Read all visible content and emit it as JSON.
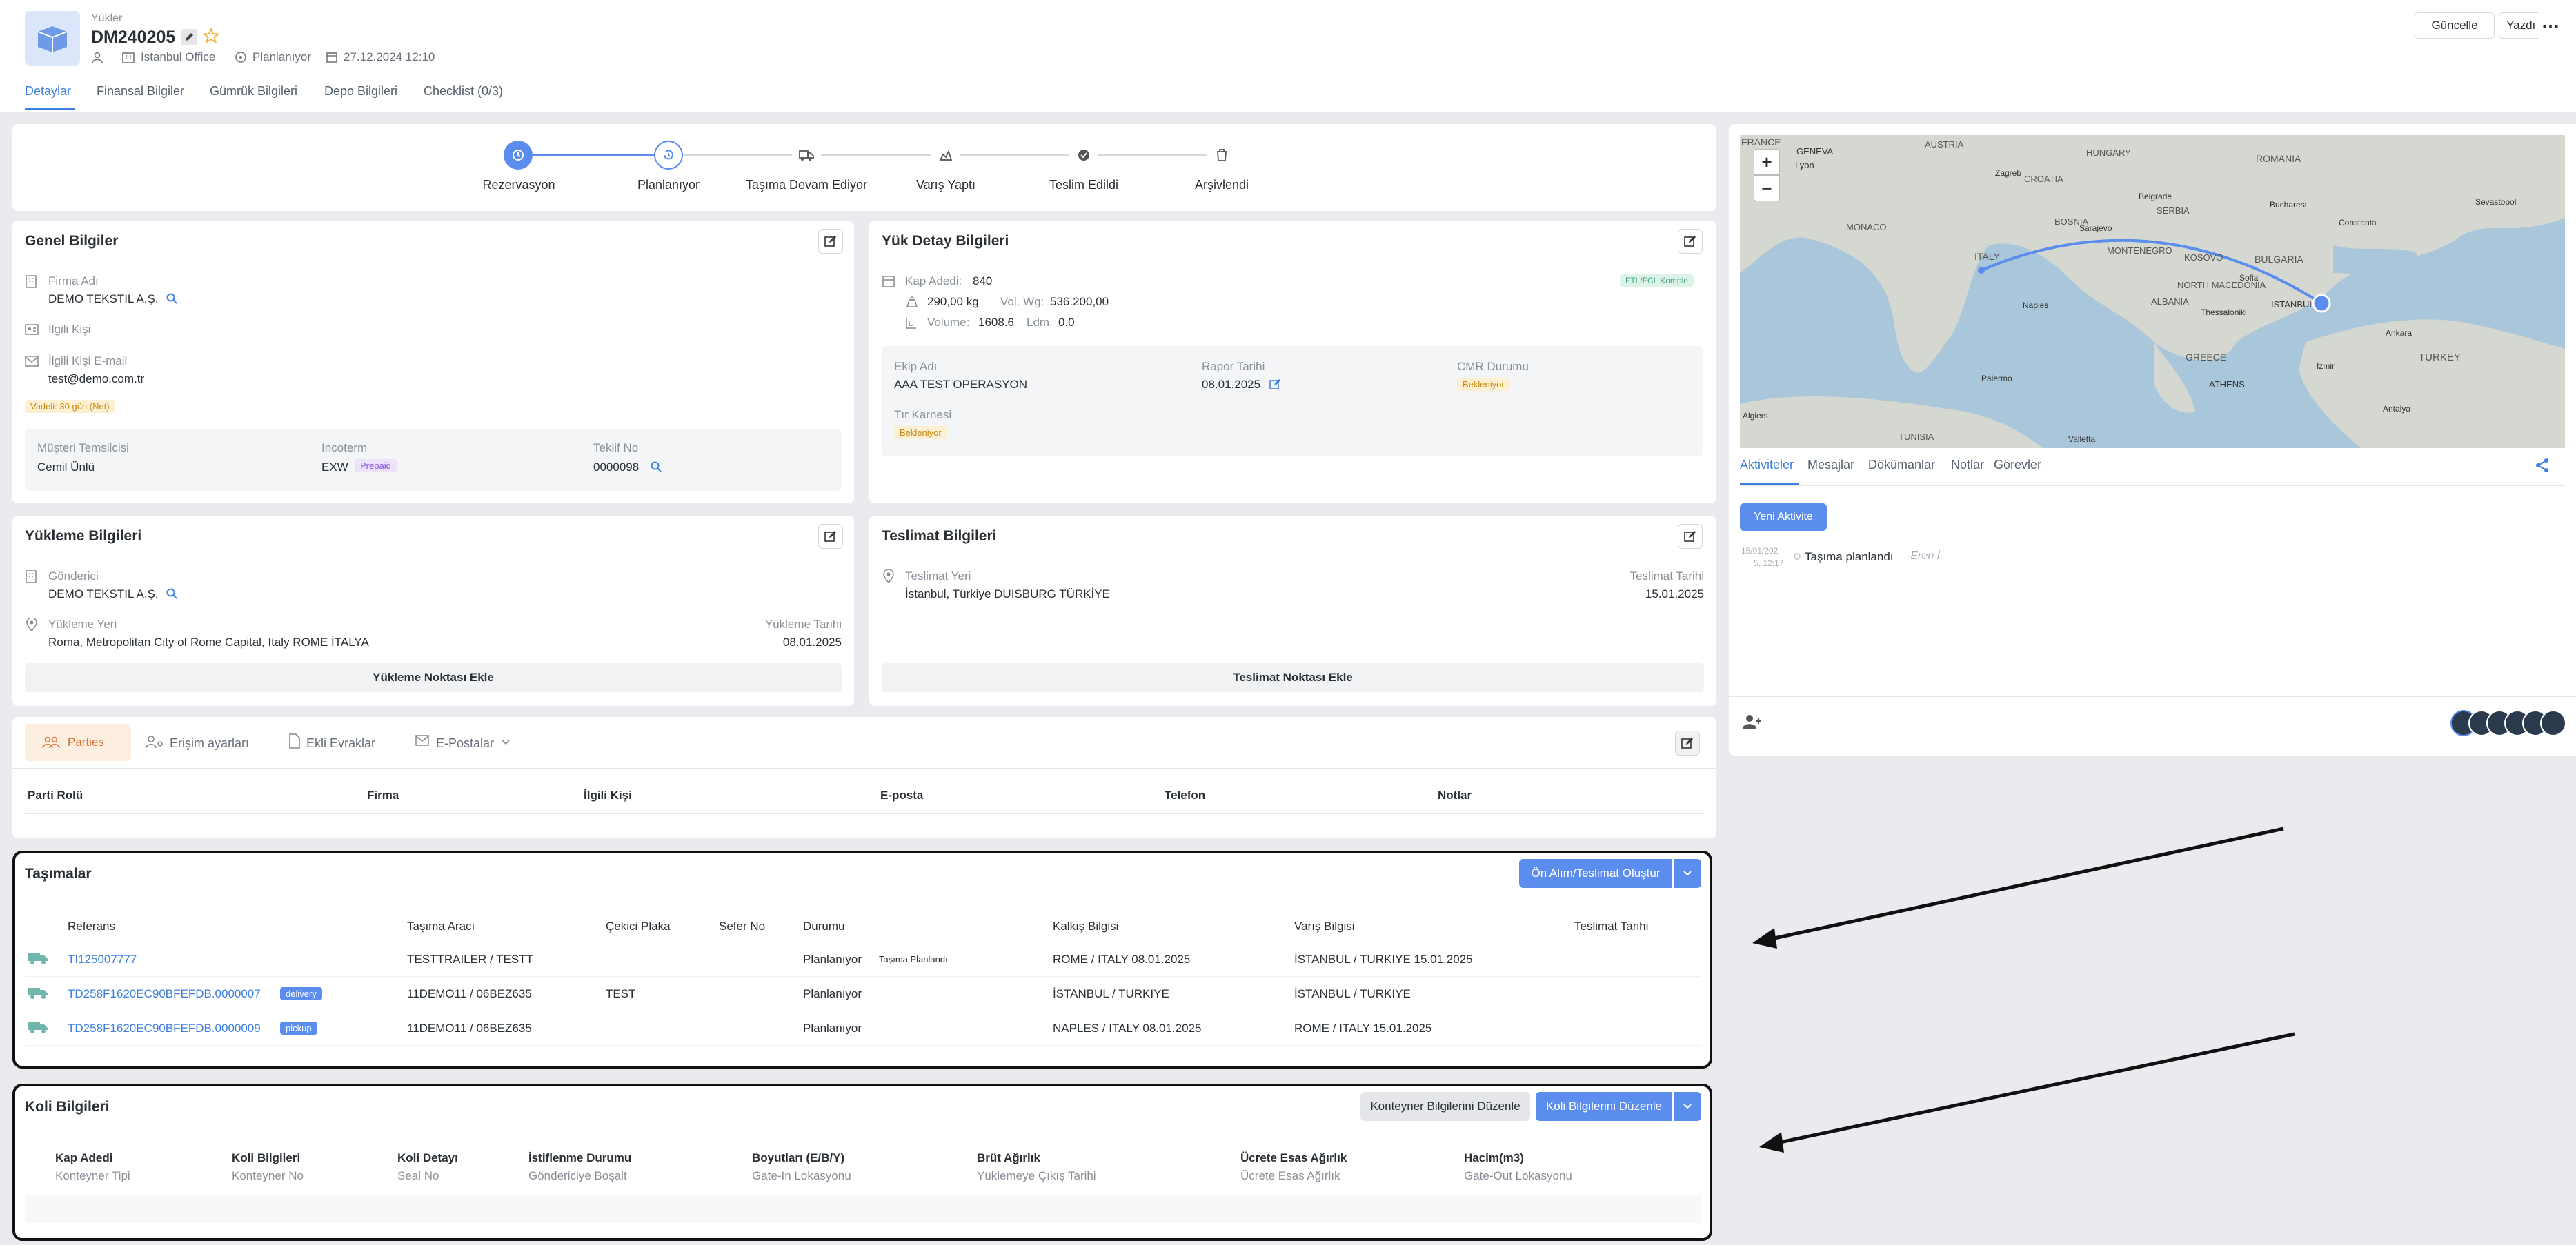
{
  "header": {
    "breadcrumb": "Yükler",
    "title": "DM240205",
    "office": "Istanbul Office",
    "status": "Planlanıyor",
    "date": "27.12.2024 12:10",
    "update_label": "Güncelle",
    "print_label": "Yazdır",
    "tabs": [
      "Detaylar",
      "Finansal Bilgiler",
      "Gümrük Bilgileri",
      "Depo Bilgileri",
      "Checklist (0/3)"
    ]
  },
  "progress": {
    "steps": [
      "Rezervasyon",
      "Planlanıyor",
      "Taşıma Devam Ediyor",
      "Varış Yaptı",
      "Teslim Edildi",
      "Arşivlendi"
    ],
    "active_index": 1
  },
  "genel": {
    "title": "Genel Bilgiler",
    "firma_label": "Firma Adı",
    "firma": "DEMO TEKSTIL A.Ş.",
    "ilgili_label": "İlgili Kişi",
    "email_label": "İlgili Kişi E-mail",
    "email": "test@demo.com.tr",
    "vade": "Vadeli: 30 gün (Net)",
    "temsilci_label": "Müşteri Temsilcisi",
    "temsilci": "Cemil Ünlü",
    "incoterm_label": "Incoterm",
    "incoterm": "EXW",
    "prepaid": "Prepaid",
    "teklif_label": "Teklif No",
    "teklif": "0000098"
  },
  "yuk": {
    "title": "Yük Detay Bilgileri",
    "kap_label": "Kap Adedi:",
    "kap": "840",
    "ftl": "FTL/FCL Komple",
    "weight": "290,00 kg",
    "volwg_label": "Vol. Wg:",
    "volwg": "536.200,00",
    "volume_label": "Volume:",
    "volume": "1608.6",
    "ldm_label": "Ldm.",
    "ldm": "0.0",
    "ekip_label": "Ekip Adı",
    "ekip": "AAA TEST OPERASYON",
    "rapor_label": "Rapor Tarihi",
    "rapor": "08.01.2025",
    "cmr_label": "CMR Durumu",
    "cmr": "Bekleniyor",
    "tir_label": "Tır Karnesi",
    "tir": "Bekleniyor"
  },
  "yukleme": {
    "title": "Yükleme Bilgileri",
    "gonderici_label": "Gönderici",
    "gonderici": "DEMO TEKSTIL A.Ş.",
    "yer_label": "Yükleme Yeri",
    "yer": "Roma, Metropolitan City of Rome Capital, Italy ROME İTALYA",
    "tarih_label": "Yükleme Tarihi",
    "tarih": "08.01.2025",
    "add_label": "Yükleme Noktası Ekle"
  },
  "teslimat": {
    "title": "Teslimat Bilgileri",
    "yer_label": "Teslimat Yeri",
    "yer": "İstanbul, Türkiye DUISBURG TÜRKİYE",
    "tarih_label": "Teslimat Tarihi",
    "tarih": "15.01.2025",
    "add_label": "Teslimat Noktası Ekle"
  },
  "parties": {
    "tabs": [
      "Parties",
      "Erişim ayarları",
      "Ekli Evraklar",
      "E-Postalar"
    ],
    "columns": [
      "Parti Rolü",
      "Firma",
      "İlgili Kişi",
      "E-posta",
      "Telefon",
      "Notlar"
    ]
  },
  "tasimalar": {
    "title": "Taşımalar",
    "create_label": "Ön Alım/Teslimat Oluştur",
    "columns": [
      "Referans",
      "Taşıma Aracı",
      "Çekici Plaka",
      "Sefer No",
      "Durumu",
      "Kalkış Bilgisi",
      "Varış Bilgisi",
      "Teslimat Tarihi"
    ],
    "rows": [
      {
        "ref": "TI125007777",
        "tag": "",
        "arac": "TESTTRAILER / TESTT",
        "cekici": "",
        "sefer": "",
        "durum": "Planlanıyor",
        "durum2": "Taşıma Planlandı",
        "kalkis": "ROME / ITALY 08.01.2025",
        "varis": "İSTANBUL / TURKIYE 15.01.2025",
        "teslimat": ""
      },
      {
        "ref": "TD258F1620EC90BFEFDB.0000007",
        "tag": "delivery",
        "arac": "11DEMO11 / 06BEZ635",
        "cekici": "TEST",
        "sefer": "",
        "durum": "Planlanıyor",
        "durum2": "",
        "kalkis": "İSTANBUL / TURKIYE",
        "varis": "İSTANBUL / TURKIYE",
        "teslimat": ""
      },
      {
        "ref": "TD258F1620EC90BFEFDB.0000009",
        "tag": "pickup",
        "arac": "11DEMO11 / 06BEZ635",
        "cekici": "",
        "sefer": "",
        "durum": "Planlanıyor",
        "durum2": "",
        "kalkis": "NAPLES / ITALY 08.01.2025",
        "varis": "ROME / ITALY 15.01.2025",
        "teslimat": ""
      }
    ]
  },
  "koli": {
    "title": "Koli Bilgileri",
    "konteyner_label": "Konteyner Bilgilerini Düzenle",
    "koli_label": "Koli Bilgilerini Düzenle",
    "columns": [
      {
        "top": "Kap Adedi",
        "bottom": "Konteyner Tipi"
      },
      {
        "top": "Koli Bilgileri",
        "bottom": "Konteyner No"
      },
      {
        "top": "Koli Detayı",
        "bottom": "Seal No"
      },
      {
        "top": "İstiflenme Durumu",
        "bottom": "Göndericiye Boşalt"
      },
      {
        "top": "Boyutları (E/B/Y)",
        "bottom": "Gate-In Lokasyonu"
      },
      {
        "top": "Brüt Ağırlık",
        "bottom": "Yüklemeye Çıkış Tarihi"
      },
      {
        "top": "Ücrete Esas Ağırlık",
        "bottom": "Ücrete Esas Ağırlık"
      },
      {
        "top": "Hacim(m3)",
        "bottom": "Gate-Out Lokasyonu"
      }
    ]
  },
  "map": {
    "zoom_in": "+",
    "zoom_out": "−",
    "labels": [
      "FRANCE",
      "GENEVA",
      "Lyon",
      "AUSTRIA",
      "HUNGARY",
      "ROMANIA",
      "CROATIA",
      "Zagreb",
      "Belgrade",
      "SERBIA",
      "Bucharest",
      "Sevastopol",
      "Constanta",
      "MONACO",
      "BOSNIA",
      "MONTENEGRO",
      "Sarajevo",
      "BULGARIA",
      "ITALY",
      "KOSOVO",
      "Sofia",
      "NORTH MACEDONIA",
      "ALBANIA",
      "Thessaloniki",
      "ISTANBUL",
      "Ankara",
      "GREECE",
      "TURKEY",
      "ATHENS",
      "Algiers",
      "Palermo",
      "Valletta",
      "TUNISIA",
      "Izmir",
      "Antalya",
      "Naples"
    ]
  },
  "activity": {
    "tabs": [
      "Aktiviteler",
      "Mesajlar",
      "Dökümanlar",
      "Notlar",
      "Görevler"
    ],
    "new_label": "Yeni Aktivite",
    "item_date": "15/01/202",
    "item_time": "5, 12:17",
    "item_text": "Taşıma planlandı",
    "item_user": "-Eren İ."
  },
  "colors": {
    "accent": "#5b8def",
    "warning": "#f2b431",
    "bg": "#e9ebef"
  }
}
